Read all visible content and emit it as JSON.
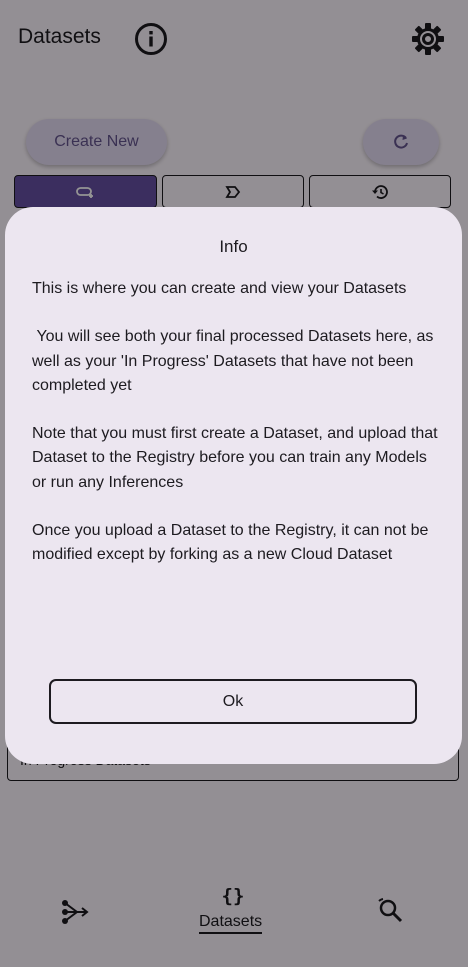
{
  "appbar": {
    "title": "Datasets",
    "info_icon": "info-icon",
    "settings_icon": "gear-icon"
  },
  "actions": {
    "create_label": "Create New",
    "refresh_icon": "refresh-icon"
  },
  "segments": [
    {
      "icon": "add-link-icon",
      "selected": true
    },
    {
      "icon": "label-icon",
      "selected": false
    },
    {
      "icon": "history-icon",
      "selected": false
    }
  ],
  "list": {
    "item_text": "In Progress Datasets"
  },
  "bottom_nav": {
    "items": [
      {
        "icon": "model-graph-icon",
        "label": ""
      },
      {
        "icon": "braces-icon",
        "glyph": "{}",
        "label": "Datasets",
        "active": true
      },
      {
        "icon": "search-icon",
        "label": ""
      }
    ]
  },
  "dialog": {
    "title": "Info",
    "paragraphs": [
      "This is where you can create and view your Datasets",
      " You will see both your final processed Datasets here, as well as your 'In Progress' Datasets that have not been completed yet",
      "Note that you must first create a Dataset, and upload that Dataset to the Registry before you can train any Models or run any Inferences",
      "Once you upload a Dataset to the Registry, it can not be modified except by forking as a new Cloud Dataset"
    ],
    "ok_label": "Ok"
  },
  "colors": {
    "background": "#fef7ff",
    "dialog": "#ece6f0",
    "primary": "#6750a4",
    "tonal": "#e6dcf4",
    "scrim": "rgba(0,0,0,0.42)"
  }
}
